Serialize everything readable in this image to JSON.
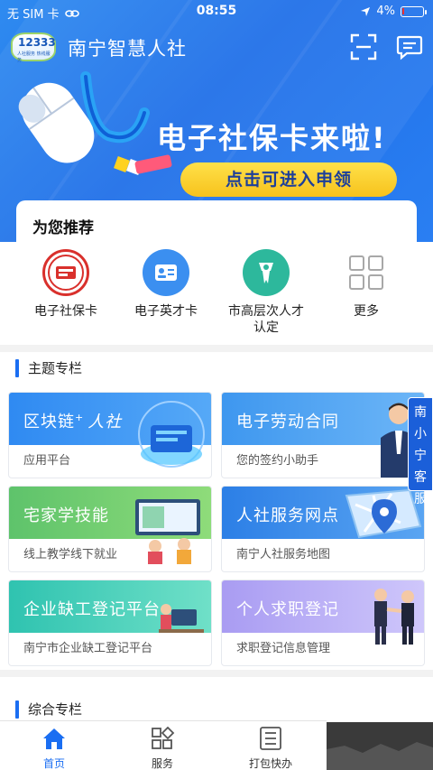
{
  "status_bar": {
    "carrier": "无 SIM 卡",
    "time": "08:55",
    "battery": "4%"
  },
  "app_bar": {
    "logo_number": "12333",
    "logo_subtitle": "人社服务 热线服务",
    "title": "南宁智慧人社"
  },
  "banner": {
    "title": "电子社保卡来啦!",
    "cta": "点击可进入申领"
  },
  "recommend": {
    "title": "为您推荐",
    "items": [
      {
        "label": "电子社保卡",
        "icon": "social-security-card-icon",
        "color": "#d9302c"
      },
      {
        "label": "电子英才卡",
        "icon": "id-card-icon",
        "color": "#3b8ff0"
      },
      {
        "label": "市高层次人才认定",
        "label_line1": "市高层次人才",
        "label_line2": "认定",
        "icon": "certificate-icon",
        "color": "#2db89c"
      },
      {
        "label": "更多",
        "icon": "grid-more-icon",
        "color": "#999999"
      }
    ]
  },
  "themes": {
    "title": "主题专栏",
    "tiles": [
      {
        "name": "区块链+人社",
        "name_a": "区块链",
        "name_b": "人社",
        "sub": "应用平台",
        "color": "#2f8af2"
      },
      {
        "name": "电子劳动合同",
        "sub": "您的签约小助手",
        "color": "#3e97ef"
      },
      {
        "name": "宅家学技能",
        "sub": "线上教学线下就业",
        "color": "#5ec36b"
      },
      {
        "name": "人社服务网点",
        "sub": "南宁人社服务地图",
        "color": "#2c7fe6"
      },
      {
        "name": "企业缺工登记平台",
        "sub": "南宁市企业缺工登记平台",
        "color": "#2fc3b0"
      },
      {
        "name": "个人求职登记",
        "sub": "求职登记信息管理",
        "color": "#a99cf2"
      }
    ]
  },
  "composite": {
    "title": "综合专栏"
  },
  "float_service": {
    "label": "南小宁客服"
  },
  "tabbar": {
    "tabs": [
      {
        "label": "首页",
        "icon": "home-icon",
        "active": true
      },
      {
        "label": "服务",
        "icon": "services-grid-icon",
        "active": false
      },
      {
        "label": "打包快办",
        "icon": "list-doc-icon",
        "active": false
      }
    ]
  },
  "colors": {
    "brand_blue": "#1a6ef2",
    "cta_yellow": "#f7c21c"
  }
}
